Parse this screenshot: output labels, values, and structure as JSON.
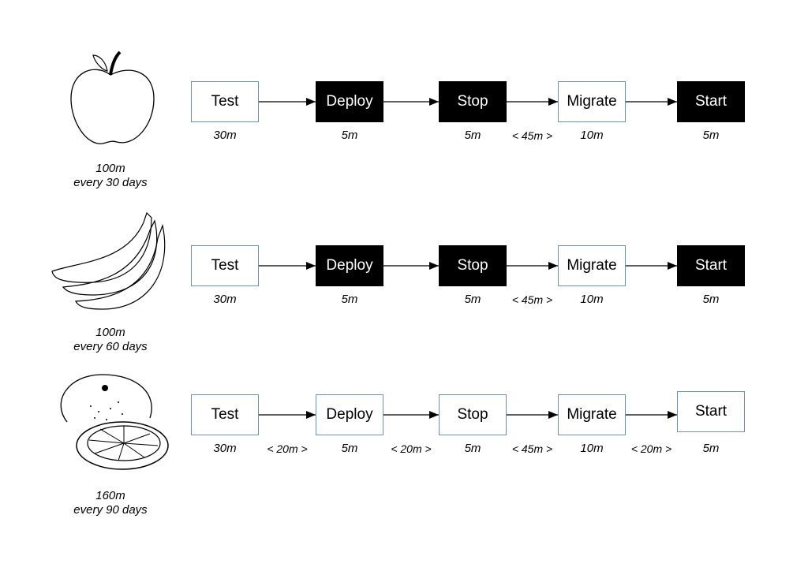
{
  "rows": [
    {
      "fruit": "apple-icon",
      "caption": [
        "100m",
        "every 30 days"
      ],
      "steps": [
        {
          "label": "Test",
          "duration": "30m",
          "dark": false
        },
        {
          "label": "Deploy",
          "duration": "5m",
          "dark": true
        },
        {
          "label": "Stop",
          "duration": "5m",
          "dark": true
        },
        {
          "label": "Migrate",
          "duration": "10m",
          "dark": false
        },
        {
          "label": "Start",
          "duration": "5m",
          "dark": true
        }
      ],
      "gaps": [
        "",
        "",
        "< 45m >",
        ""
      ]
    },
    {
      "fruit": "banana-icon",
      "caption": [
        "100m",
        "every 60 days"
      ],
      "steps": [
        {
          "label": "Test",
          "duration": "30m",
          "dark": false
        },
        {
          "label": "Deploy",
          "duration": "5m",
          "dark": true
        },
        {
          "label": "Stop",
          "duration": "5m",
          "dark": true
        },
        {
          "label": "Migrate",
          "duration": "10m",
          "dark": false
        },
        {
          "label": "Start",
          "duration": "5m",
          "dark": true
        }
      ],
      "gaps": [
        "",
        "",
        "< 45m >",
        ""
      ]
    },
    {
      "fruit": "orange-icon",
      "caption": [
        "160m",
        "every 90 days"
      ],
      "steps": [
        {
          "label": "Test",
          "duration": "30m",
          "dark": false
        },
        {
          "label": "Deploy",
          "duration": "5m",
          "dark": false
        },
        {
          "label": "Stop",
          "duration": "5m",
          "dark": false
        },
        {
          "label": "Migrate",
          "duration": "10m",
          "dark": false
        },
        {
          "label": "Start",
          "duration": "5m",
          "dark": false
        }
      ],
      "gaps": [
        "< 20m >",
        "< 20m >",
        "< 45m >",
        "< 20m >"
      ]
    }
  ],
  "colors": {
    "box_border": "#6c8ebf",
    "dark_fill": "#000000"
  }
}
